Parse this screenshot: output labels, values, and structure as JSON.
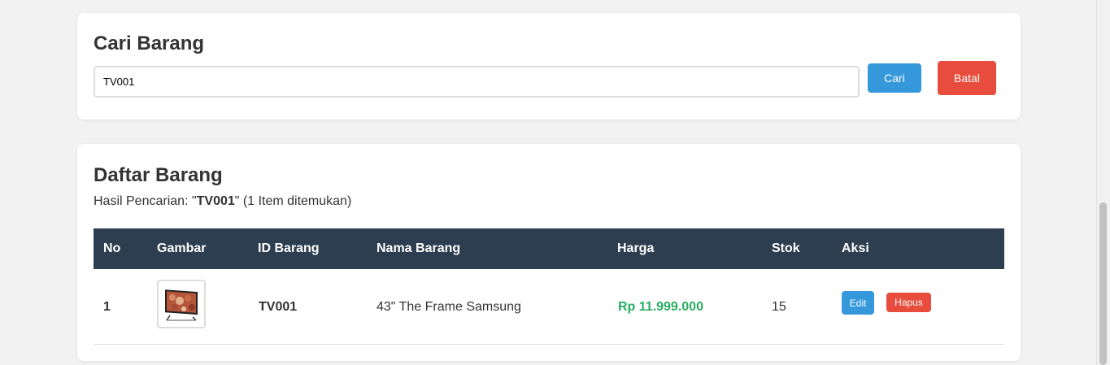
{
  "search": {
    "title": "Cari Barang",
    "input_value": "TV001",
    "search_label": "Cari",
    "cancel_label": "Batal"
  },
  "list": {
    "title": "Daftar Barang",
    "result_prefix": "Hasil Pencarian: \"",
    "result_query": "TV001",
    "result_suffix": "\" (1 Item ditemukan)",
    "columns": [
      "No",
      "Gambar",
      "ID Barang",
      "Nama Barang",
      "Harga",
      "Stok",
      "Aksi"
    ],
    "rows": [
      {
        "no": "1",
        "id": "TV001",
        "name": "43\" The Frame Samsung",
        "price": "Rp 11.999.000",
        "stock": "15",
        "edit_label": "Edit",
        "delete_label": "Hapus"
      }
    ]
  },
  "colors": {
    "header_bg": "#2c3e50",
    "primary": "#3498db",
    "danger": "#e74c3c",
    "price": "#27ae60"
  },
  "icons": {
    "product_image": "tv-image"
  }
}
